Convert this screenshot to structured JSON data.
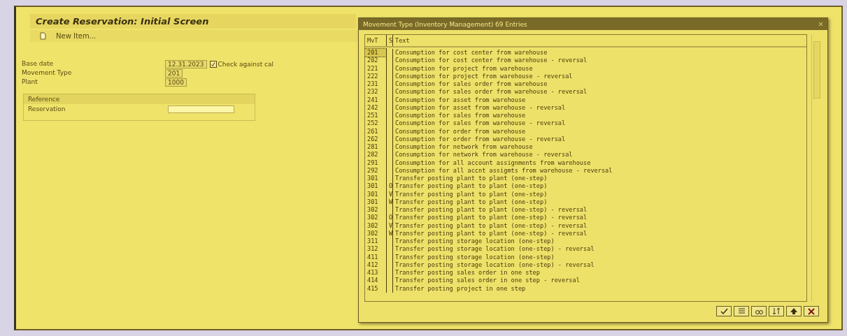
{
  "main_window": {
    "title": "Create Reservation: Initial Screen",
    "toolbar": [
      {
        "label": "New Item..."
      }
    ],
    "fields": [
      {
        "label": "Base date",
        "value": "12.31.2023",
        "checkbox": {
          "label": "Check against cal",
          "checked": true
        }
      },
      {
        "label": "Movement Type",
        "value": "201"
      },
      {
        "label": "Plant",
        "value": "1000"
      }
    ],
    "reference": {
      "title": "Reference",
      "fields": [
        {
          "label": "Reservation"
        }
      ]
    }
  },
  "dialog": {
    "title": "Movement Type (Inventory Management) 69 Entries",
    "columns": [
      "MvT",
      "S",
      "Text"
    ],
    "rows": [
      {
        "mvt": "201",
        "s": "",
        "text": "Consumption for cost center from warehouse",
        "selected": true
      },
      {
        "mvt": "202",
        "s": "",
        "text": "Consumption for cost center from warehouse - reversal",
        "selected": false
      },
      {
        "mvt": "221",
        "s": "",
        "text": "Consumption for project from warehouse",
        "selected": false
      },
      {
        "mvt": "222",
        "s": "",
        "text": "Consumption for project from warehouse - reversal",
        "selected": false
      },
      {
        "mvt": "231",
        "s": "",
        "text": "Consumption for sales order from warehouse",
        "selected": false
      },
      {
        "mvt": "232",
        "s": "",
        "text": "Consumption for sales order from warehouse - reversal",
        "selected": false
      },
      {
        "mvt": "241",
        "s": "",
        "text": "Consumption for asset from warehouse",
        "selected": false
      },
      {
        "mvt": "242",
        "s": "",
        "text": "Consumption for asset from warehouse - reversal",
        "selected": false
      },
      {
        "mvt": "251",
        "s": "",
        "text": "Consumption for sales from warehouse",
        "selected": false
      },
      {
        "mvt": "252",
        "s": "",
        "text": "Consumption for sales from warehouse - reversal",
        "selected": false
      },
      {
        "mvt": "261",
        "s": "",
        "text": "Consumption for order from warehouse",
        "selected": false
      },
      {
        "mvt": "262",
        "s": "",
        "text": "Consumption for order from warehouse - reversal",
        "selected": false
      },
      {
        "mvt": "281",
        "s": "",
        "text": "Consumption for network from warehouse",
        "selected": false
      },
      {
        "mvt": "282",
        "s": "",
        "text": "Consumption for network from warehouse - reversal",
        "selected": false
      },
      {
        "mvt": "291",
        "s": "",
        "text": "Consumption for all account assignments from warehouse",
        "selected": false
      },
      {
        "mvt": "292",
        "s": "",
        "text": "Consumption for all accnt assigmts from warehouse - reversal",
        "selected": false
      },
      {
        "mvt": "301",
        "s": "",
        "text": "Transfer posting plant to plant (one-step)",
        "selected": false
      },
      {
        "mvt": "301",
        "s": "O",
        "text": "Transfer posting plant to plant (one-step)",
        "selected": false
      },
      {
        "mvt": "301",
        "s": "V",
        "text": "Transfer posting plant to plant (one-step)",
        "selected": false
      },
      {
        "mvt": "301",
        "s": "W",
        "text": "Transfer posting plant to plant (one-step)",
        "selected": false
      },
      {
        "mvt": "302",
        "s": "",
        "text": "Transfer posting plant to plant (one-step) - reversal",
        "selected": false
      },
      {
        "mvt": "302",
        "s": "O",
        "text": "Transfer posting plant to plant (one-step) - reversal",
        "selected": false
      },
      {
        "mvt": "302",
        "s": "V",
        "text": "Transfer posting plant to plant (one-step) - reversal",
        "selected": false
      },
      {
        "mvt": "302",
        "s": "W",
        "text": "Transfer posting plant to plant (one-step) - reversal",
        "selected": false
      },
      {
        "mvt": "311",
        "s": "",
        "text": "Transfer posting storage location (one-step)",
        "selected": false
      },
      {
        "mvt": "312",
        "s": "",
        "text": "Transfer posting storage location (one-step) - reversal",
        "selected": false
      },
      {
        "mvt": "411",
        "s": "",
        "text": "Transfer posting storage location (one-step)",
        "selected": false
      },
      {
        "mvt": "412",
        "s": "",
        "text": "Transfer posting storage location (one-step) - reversal",
        "selected": false
      },
      {
        "mvt": "413",
        "s": "",
        "text": "Transfer posting sales order in one step",
        "selected": false
      },
      {
        "mvt": "414",
        "s": "",
        "text": "Transfer posting sales order in one step - reversal",
        "selected": false
      },
      {
        "mvt": "415",
        "s": "",
        "text": "Transfer posting project in one step",
        "selected": false
      }
    ],
    "buttons": [
      {
        "kind": "check"
      },
      {
        "kind": "list"
      },
      {
        "kind": "find"
      },
      {
        "kind": "sort"
      },
      {
        "kind": "up"
      },
      {
        "kind": "cancel"
      }
    ]
  }
}
